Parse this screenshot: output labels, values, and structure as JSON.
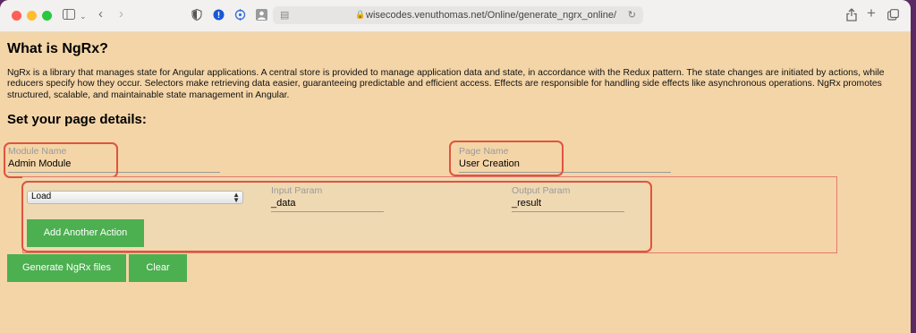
{
  "browser": {
    "url": "wisecodes.venuthomas.net/Online/generate_ngrx_online/"
  },
  "page": {
    "title": "What is NgRx?",
    "intro": "NgRx is a library that manages state for Angular applications. A central store is provided to manage application data and state, in accordance with the Redux pattern. The state changes are initiated by actions, while reducers specify how they occur. Selectors make retrieving data easier, guaranteeing predictable and efficient access. Effects are responsible for handling side effects like asynchronous operations. NgRx promotes structured, scalable, and maintainable state management in Angular.",
    "subtitle": "Set your page details:"
  },
  "form": {
    "module_name": {
      "label": "Module Name",
      "value": "Admin Module"
    },
    "page_name": {
      "label": "Page Name",
      "value": "User Creation"
    },
    "action": {
      "selected": "Load",
      "input_param": {
        "label": "Input Param",
        "value": "_data"
      },
      "output_param": {
        "label": "Output Param",
        "value": "_result"
      }
    },
    "add_action_label": "Add Another Action",
    "generate_label": "Generate NgRx files",
    "clear_label": "Clear"
  },
  "colors": {
    "background": "#f4d5a7",
    "button": "#4caf50",
    "highlight": "#e0533f"
  }
}
